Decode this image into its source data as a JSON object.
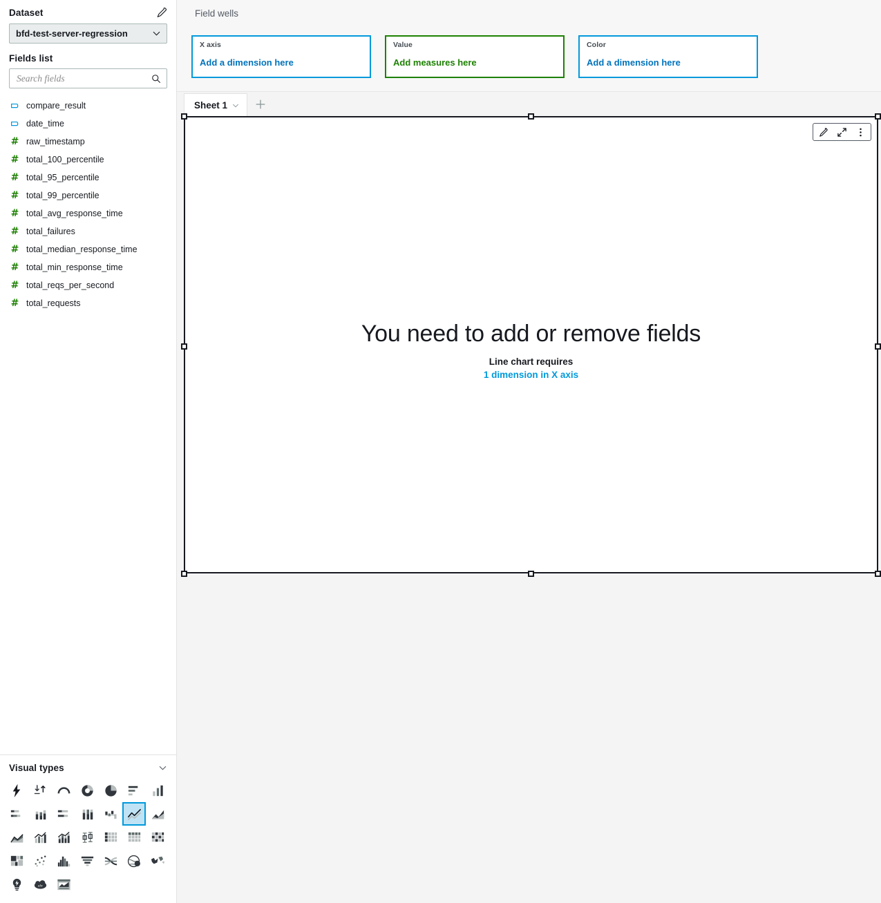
{
  "sidebar": {
    "dataset": {
      "title": "Dataset",
      "edit_icon": "pencil-icon",
      "selected": "bfd-test-server-regression",
      "chevron_icon": "chevron-down-icon"
    },
    "fields": {
      "title": "Fields list",
      "search_placeholder": "Search fields",
      "search_icon": "search-icon",
      "items": [
        {
          "name": "compare_result",
          "type": "string",
          "icon": "string-field-icon"
        },
        {
          "name": "date_time",
          "type": "string",
          "icon": "string-field-icon"
        },
        {
          "name": "raw_timestamp",
          "type": "number",
          "icon": "number-field-icon"
        },
        {
          "name": "total_100_percentile",
          "type": "number",
          "icon": "number-field-icon"
        },
        {
          "name": "total_95_percentile",
          "type": "number",
          "icon": "number-field-icon"
        },
        {
          "name": "total_99_percentile",
          "type": "number",
          "icon": "number-field-icon"
        },
        {
          "name": "total_avg_response_time",
          "type": "number",
          "icon": "number-field-icon"
        },
        {
          "name": "total_failures",
          "type": "number",
          "icon": "number-field-icon"
        },
        {
          "name": "total_median_response_time",
          "type": "number",
          "icon": "number-field-icon"
        },
        {
          "name": "total_min_response_time",
          "type": "number",
          "icon": "number-field-icon"
        },
        {
          "name": "total_reqs_per_second",
          "type": "number",
          "icon": "number-field-icon"
        },
        {
          "name": "total_requests",
          "type": "number",
          "icon": "number-field-icon"
        }
      ]
    },
    "visual_types": {
      "title": "Visual types",
      "collapse_icon": "chevron-down-icon",
      "selected": "line-chart",
      "items": [
        {
          "id": "autograph",
          "label": "AutoGraph"
        },
        {
          "id": "kpi",
          "label": "KPI"
        },
        {
          "id": "gauge",
          "label": "Gauge chart"
        },
        {
          "id": "donut",
          "label": "Donut chart"
        },
        {
          "id": "pie",
          "label": "Pie chart"
        },
        {
          "id": "horizontal-bar",
          "label": "Horizontal bar chart"
        },
        {
          "id": "vertical-bar",
          "label": "Vertical bar chart"
        },
        {
          "id": "horizontal-stacked-bar",
          "label": "Horizontal stacked bar chart"
        },
        {
          "id": "vertical-stacked-bar",
          "label": "Vertical stacked bar chart"
        },
        {
          "id": "horizontal-stacked-100-bar",
          "label": "Horizontal stacked 100% bar chart"
        },
        {
          "id": "vertical-stacked-100-bar",
          "label": "Vertical stacked 100% bar chart"
        },
        {
          "id": "waterfall",
          "label": "Waterfall chart"
        },
        {
          "id": "line-chart",
          "label": "Line chart"
        },
        {
          "id": "area-line-chart",
          "label": "Area line chart"
        },
        {
          "id": "stacked-area-line",
          "label": "Stacked area line chart"
        },
        {
          "id": "clustered-combo",
          "label": "Clustered bar combo chart"
        },
        {
          "id": "stacked-combo",
          "label": "Stacked bar combo chart"
        },
        {
          "id": "box-plot",
          "label": "Box plot"
        },
        {
          "id": "pivot-table",
          "label": "Pivot table"
        },
        {
          "id": "table",
          "label": "Table"
        },
        {
          "id": "heat-map",
          "label": "Heat map"
        },
        {
          "id": "tree-map",
          "label": "Tree map"
        },
        {
          "id": "scatter-plot",
          "label": "Scatter plot"
        },
        {
          "id": "histogram",
          "label": "Histogram"
        },
        {
          "id": "funnel-chart",
          "label": "Funnel chart"
        },
        {
          "id": "sankey-diagram",
          "label": "Sankey diagram"
        },
        {
          "id": "points-on-map",
          "label": "Points on map"
        },
        {
          "id": "filled-map",
          "label": "Filled map"
        },
        {
          "id": "insight",
          "label": "Insight"
        },
        {
          "id": "word-cloud",
          "label": "Word cloud"
        },
        {
          "id": "custom-visual",
          "label": "Custom visual content"
        }
      ]
    }
  },
  "field_wells": {
    "title": "Field wells",
    "wells": [
      {
        "label": "X axis",
        "cta": "Add a dimension here",
        "kind": "dimension"
      },
      {
        "label": "Value",
        "cta": "Add measures here",
        "kind": "measure"
      },
      {
        "label": "Color",
        "cta": "Add a dimension here",
        "kind": "dimension"
      }
    ]
  },
  "sheets": {
    "active": "Sheet 1",
    "menu_icon": "chevron-down-icon",
    "add_icon": "plus-icon"
  },
  "visual": {
    "toolbar": [
      {
        "id": "edit",
        "icon": "pencil-icon"
      },
      {
        "id": "maximize",
        "icon": "expand-arrows-icon"
      },
      {
        "id": "menu",
        "icon": "kebab-menu-icon"
      }
    ],
    "empty_state": {
      "title": "You need to add or remove fields",
      "subtitle": "Line chart requires",
      "requirement": "1 dimension in X axis"
    }
  },
  "colors": {
    "dimension_blue": "#0099db",
    "link_blue": "#0073bb",
    "measure_green": "#1d8102",
    "selection_fill": "#bfe3f5"
  }
}
